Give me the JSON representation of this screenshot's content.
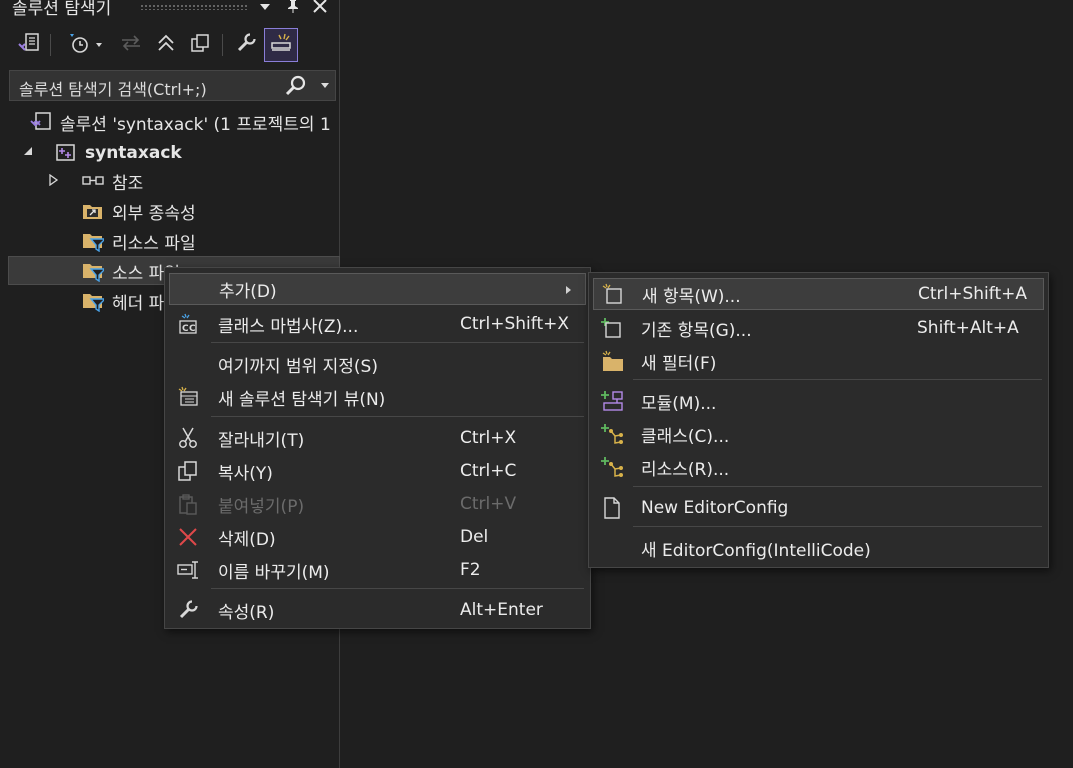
{
  "panel": {
    "title": "솔루션 탐색기",
    "search_placeholder": "솔루션 탐색기 검색(Ctrl+;)",
    "toolbar": [
      "solution-switch",
      "history",
      "sync-back",
      "collapse-all",
      "show-all-files",
      "properties",
      "preview-selected"
    ]
  },
  "tree": {
    "solution": "솔루션 'syntaxack' (1 프로젝트의 1",
    "project": "syntaxack",
    "items": [
      {
        "label": "참조",
        "icon": "reference-icon"
      },
      {
        "label": "외부 종속성",
        "icon": "external-deps-icon"
      },
      {
        "label": "리소스 파일",
        "icon": "filter-folder-icon"
      },
      {
        "label": "소스 파일",
        "icon": "filter-folder-icon"
      },
      {
        "label": "헤더 파일",
        "icon": "filter-folder-icon"
      }
    ]
  },
  "context_menu": {
    "items": [
      {
        "label": "추가(D)",
        "shortcut": "",
        "submenu": true
      },
      {
        "label": "클래스 마법사(Z)...",
        "shortcut": "Ctrl+Shift+X"
      },
      {
        "label": "여기까지 범위 지정(S)",
        "shortcut": ""
      },
      {
        "label": "새 솔루션 탐색기 뷰(N)",
        "shortcut": ""
      },
      {
        "label": "잘라내기(T)",
        "shortcut": "Ctrl+X"
      },
      {
        "label": "복사(Y)",
        "shortcut": "Ctrl+C"
      },
      {
        "label": "붙여넣기(P)",
        "shortcut": "Ctrl+V",
        "disabled": true
      },
      {
        "label": "삭제(D)",
        "shortcut": "Del"
      },
      {
        "label": "이름 바꾸기(M)",
        "shortcut": "F2"
      },
      {
        "label": "속성(R)",
        "shortcut": "Alt+Enter"
      }
    ]
  },
  "submenu": {
    "items": [
      {
        "label": "새 항목(W)...",
        "shortcut": "Ctrl+Shift+A"
      },
      {
        "label": "기존 항목(G)...",
        "shortcut": "Shift+Alt+A"
      },
      {
        "label": "새 필터(F)",
        "shortcut": ""
      },
      {
        "label": "모듈(M)...",
        "shortcut": ""
      },
      {
        "label": "클래스(C)...",
        "shortcut": ""
      },
      {
        "label": "리소스(R)...",
        "shortcut": ""
      },
      {
        "label": "New EditorConfig",
        "shortcut": ""
      },
      {
        "label": "새 EditorConfig(IntelliCode)",
        "shortcut": ""
      }
    ]
  },
  "colors": {
    "accent": "#8a7ed8",
    "background": "#1f1f1f",
    "menu": "#2b2b2b",
    "delete": "#e0484a",
    "add_green": "#5fb85f",
    "folder": "#d9b36a"
  }
}
